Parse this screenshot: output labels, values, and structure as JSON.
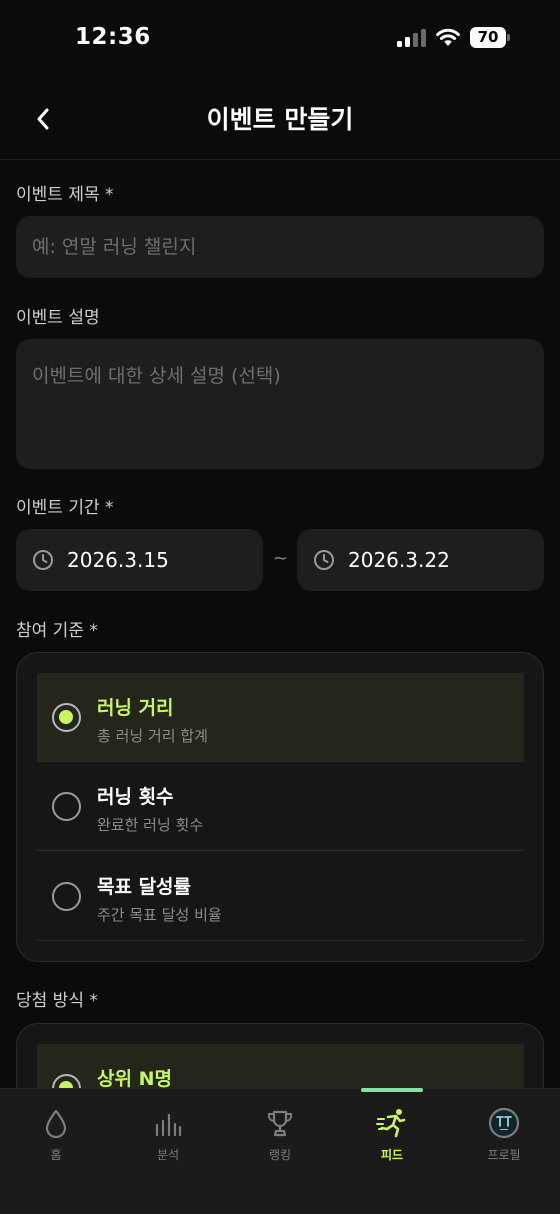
{
  "status": {
    "time": "12:36",
    "battery": "70"
  },
  "header": {
    "title": "이벤트 만들기"
  },
  "form": {
    "title_label": "이벤트 제목",
    "title_placeholder": "예: 연말 러닝 챌린지",
    "desc_label": "이벤트 설명",
    "desc_placeholder": "이벤트에 대한 상세 설명 (선택)",
    "period_label": "이벤트 기간",
    "start_date": "2026.3.15",
    "end_date": "2026.3.22",
    "separator": "~",
    "required_mark": "*"
  },
  "criteria": {
    "label": "참여 기준",
    "options": [
      {
        "title": "러닝 거리",
        "sub": "총 러닝 거리 합계",
        "selected": true
      },
      {
        "title": "러닝 횟수",
        "sub": "완료한 러닝 횟수",
        "selected": false
      },
      {
        "title": "목표 달성률",
        "sub": "주간 목표 달성 비율",
        "selected": false
      }
    ]
  },
  "winner": {
    "label": "당첨 방식",
    "options": [
      {
        "title": "상위 N명",
        "selected": true
      }
    ]
  },
  "tabs": [
    {
      "label": "홈",
      "icon": "drop-icon",
      "active": false
    },
    {
      "label": "분석",
      "icon": "bar-chart-icon",
      "active": false
    },
    {
      "label": "랭킹",
      "icon": "trophy-icon",
      "active": false
    },
    {
      "label": "피드",
      "icon": "runner-icon",
      "active": true
    },
    {
      "label": "프로필",
      "icon": "profile-icon",
      "active": false
    }
  ],
  "colors": {
    "accent": "#c8f560",
    "indicator": "#7ee6a0",
    "background": "#0b0b0b",
    "field": "#1e1e1e"
  }
}
